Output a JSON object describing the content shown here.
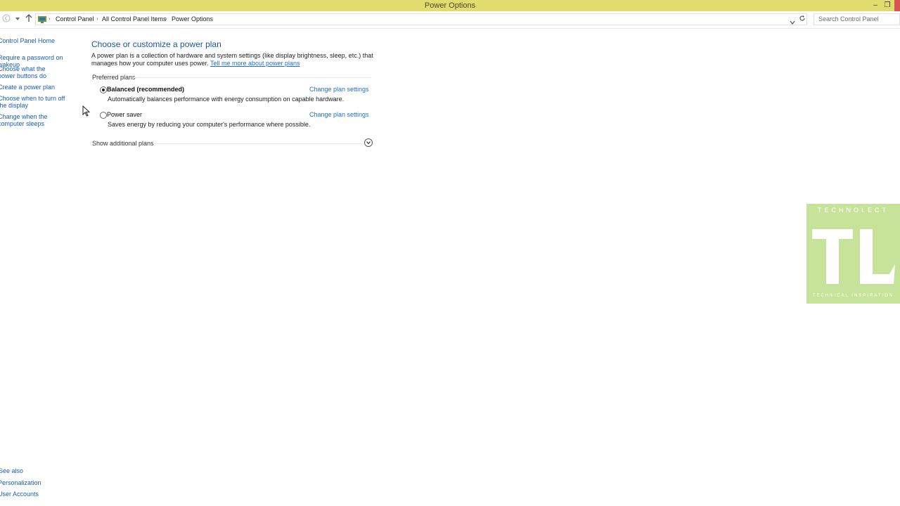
{
  "window": {
    "title": "Power Options",
    "controls": {
      "minimize": "–",
      "maximize": "❐"
    }
  },
  "address_bar": {
    "back_icon": "left-arrow",
    "forward_icon": "chevron-down",
    "up_icon": "up-arrow",
    "breadcrumbs": [
      "Control Panel",
      "All Control Panel Items",
      "Power Options"
    ],
    "refresh_icon": "refresh",
    "search_placeholder": "Search Control Panel"
  },
  "left_nav": {
    "home": "Control Panel Home",
    "links": [
      "Require a password on wakeup",
      "Choose what the power buttons do",
      "Create a power plan",
      "Choose when to turn off the display",
      "Change when the computer sleeps"
    ],
    "see_also_label": "See also",
    "see_also": [
      "Personalization",
      "User Accounts"
    ]
  },
  "main": {
    "title": "Choose or customize a power plan",
    "description": "A power plan is a collection of hardware and system settings (like display brightness, sleep, etc.) that manages how your computer uses power.",
    "learn_link": "Tell me more about power plans",
    "preferred_label": "Preferred plans",
    "plans": [
      {
        "name": "Balanced (recommended)",
        "selected": true,
        "description": "Automatically balances performance with energy consumption on capable hardware.",
        "link": "Change plan settings"
      },
      {
        "name": "Power saver",
        "selected": false,
        "description": "Saves energy by reducing your computer's performance where possible.",
        "link": "Change plan settings"
      }
    ],
    "show_additional": "Show additional plans"
  },
  "watermark": {
    "top": "TECHNOLECT",
    "logo": "TL",
    "bottom": "TECHNICAL INSPIRATION"
  },
  "colors": {
    "title_bar": "#e2dc6f",
    "link": "#1f6fcf",
    "heading": "#1a56a6",
    "watermark": "#c7e39a"
  }
}
